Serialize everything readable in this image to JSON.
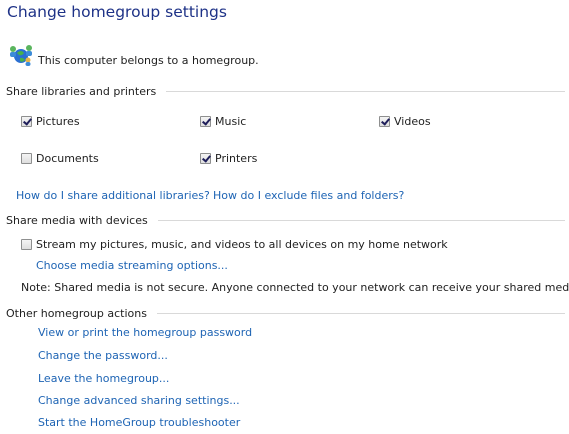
{
  "page": {
    "title": "Change homegroup settings"
  },
  "status": {
    "text": "This computer belongs to a homegroup.",
    "icon": "homegroup-icon"
  },
  "share_libraries": {
    "heading": "Share libraries and printers",
    "items": [
      {
        "label": "Pictures",
        "checked": true
      },
      {
        "label": "Music",
        "checked": true
      },
      {
        "label": "Videos",
        "checked": true
      },
      {
        "label": "Documents",
        "checked": false
      },
      {
        "label": "Printers",
        "checked": true
      }
    ],
    "links": [
      "How do I share additional libraries?",
      "How do I exclude files and folders?"
    ]
  },
  "share_media": {
    "heading": "Share media with devices",
    "stream": {
      "label": "Stream my pictures, music, and videos to all devices on my home network",
      "checked": false
    },
    "options_link": "Choose media streaming options...",
    "note": "Note: Shared media is not secure. Anyone connected to your network can receive your shared media."
  },
  "other_actions": {
    "heading": "Other homegroup actions",
    "links": [
      "View or print the homegroup password",
      "Change the password...",
      "Leave the homegroup...",
      "Change advanced sharing settings...",
      "Start the HomeGroup troubleshooter"
    ]
  },
  "colors": {
    "title": "#1e3287",
    "link": "#1e64b4",
    "rule": "#d9d9d9"
  }
}
